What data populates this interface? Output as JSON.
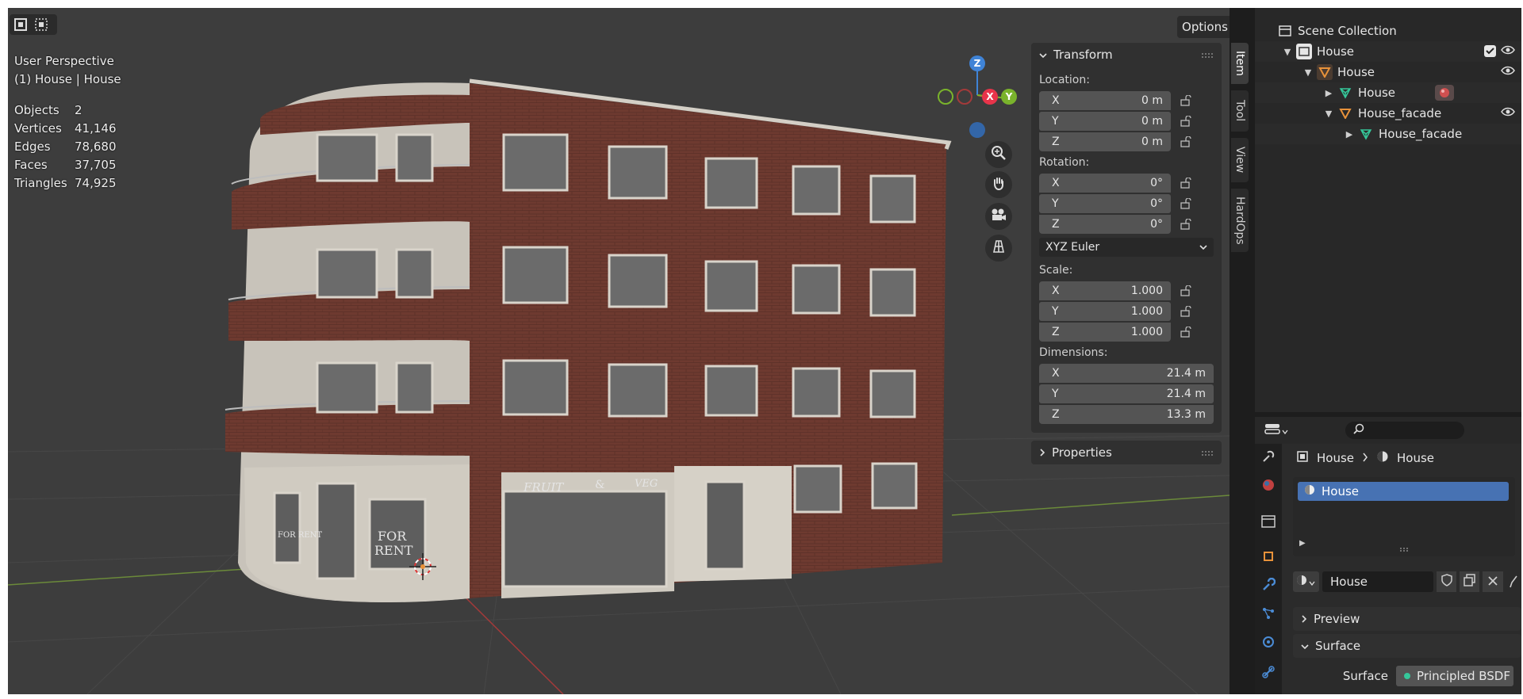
{
  "viewport": {
    "perspective_label": "User Perspective",
    "object_label": "(1) House | House",
    "stats": [
      {
        "label": "Objects",
        "value": "2"
      },
      {
        "label": "Vertices",
        "value": "41,146"
      },
      {
        "label": "Edges",
        "value": "78,680"
      },
      {
        "label": "Faces",
        "value": "37,705"
      },
      {
        "label": "Triangles",
        "value": "74,925"
      }
    ],
    "options_label": "Options",
    "gizmo": {
      "z": "Z",
      "x": "X",
      "y": "Y"
    },
    "signs": {
      "for_rent_small": "FOR RENT",
      "for_rent_big_1": "FOR",
      "for_rent_big_2": "RENT",
      "fruit": "FRUIT",
      "amp": "&",
      "veg": "VEG"
    }
  },
  "npanel": {
    "transform_title": "Transform",
    "location_label": "Location:",
    "location": [
      {
        "axis": "X",
        "value": "0 m"
      },
      {
        "axis": "Y",
        "value": "0 m"
      },
      {
        "axis": "Z",
        "value": "0 m"
      }
    ],
    "rotation_label": "Rotation:",
    "rotation": [
      {
        "axis": "X",
        "value": "0°"
      },
      {
        "axis": "Y",
        "value": "0°"
      },
      {
        "axis": "Z",
        "value": "0°"
      }
    ],
    "rotation_mode": "XYZ Euler",
    "scale_label": "Scale:",
    "scale": [
      {
        "axis": "X",
        "value": "1.000"
      },
      {
        "axis": "Y",
        "value": "1.000"
      },
      {
        "axis": "Z",
        "value": "1.000"
      }
    ],
    "dimensions_label": "Dimensions:",
    "dimensions": [
      {
        "axis": "X",
        "value": "21.4 m"
      },
      {
        "axis": "Y",
        "value": "21.4 m"
      },
      {
        "axis": "Z",
        "value": "13.3 m"
      }
    ],
    "properties_title": "Properties"
  },
  "sidetabs": [
    "Item",
    "Tool",
    "View",
    "HardOps"
  ],
  "outliner": {
    "scene_collection": "Scene Collection",
    "rows": [
      "House",
      "House",
      "House",
      "House_facade",
      "House_facade"
    ]
  },
  "properties": {
    "breadcrumb_object": "House",
    "breadcrumb_material": "House",
    "slot_name": "House",
    "material_name": "House",
    "preview_label": "Preview",
    "surface_panel_label": "Surface",
    "surface_field_label": "Surface",
    "surface_shader": "Principled BSDF"
  },
  "colors": {
    "accent": "#4772b3",
    "x_axis": "#e8344a",
    "y_axis": "#7ab32c",
    "z_axis": "#3f83d6",
    "object_orange": "#e8923a",
    "mesh_green": "#35c79a"
  }
}
